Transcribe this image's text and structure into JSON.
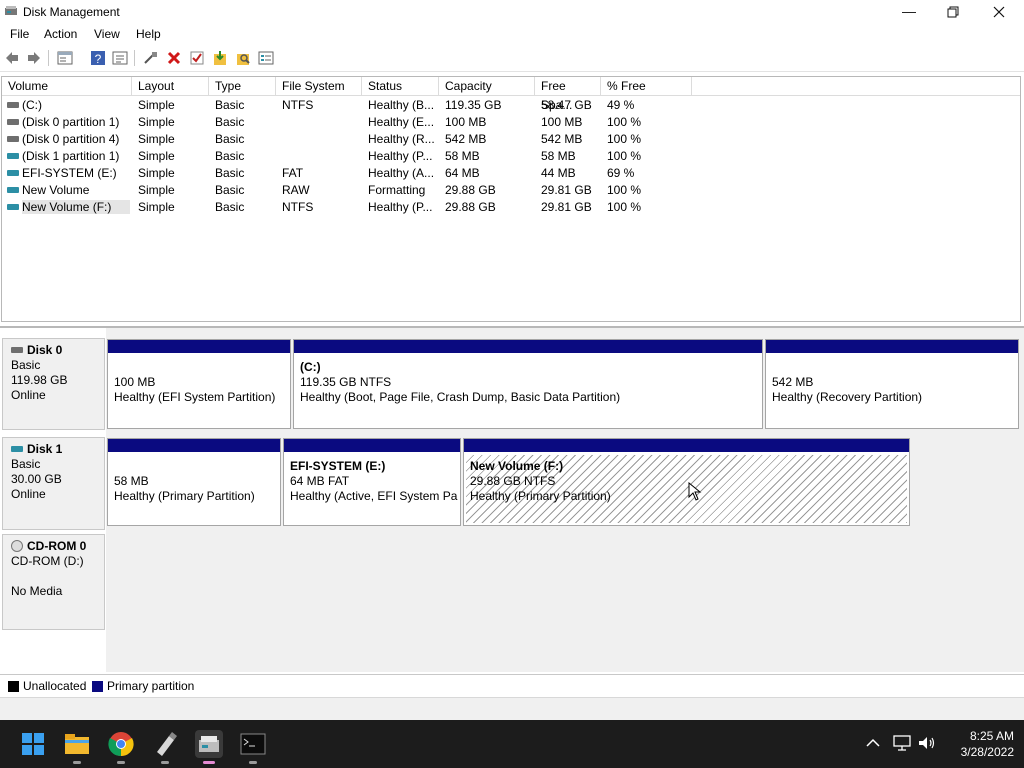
{
  "window": {
    "title": "Disk Management",
    "minimize_icon": "minimize-icon",
    "maximize_icon": "maximize-icon",
    "close_icon": "close-icon"
  },
  "menu": [
    "File",
    "Action",
    "View",
    "Help"
  ],
  "toolbar": {
    "icons": [
      "back-icon",
      "forward-icon",
      "properties-icon",
      "help-icon",
      "details-icon",
      "connect-icon",
      "delete-icon",
      "check-icon",
      "import-icon",
      "search-icon",
      "list-icon"
    ]
  },
  "volume_list": {
    "columns": [
      "Volume",
      "Layout",
      "Type",
      "File System",
      "Status",
      "Capacity",
      "Free Spa...",
      "% Free"
    ],
    "rows": [
      {
        "volume": " (C:)",
        "layout": "Simple",
        "type": "Basic",
        "fs": "NTFS",
        "status": "Healthy (B...",
        "capacity": "119.35 GB",
        "free": "58.47 GB",
        "pct": "49 %",
        "icon": "gray"
      },
      {
        "volume": "(Disk 0 partition 1)",
        "layout": "Simple",
        "type": "Basic",
        "fs": "",
        "status": "Healthy (E...",
        "capacity": "100 MB",
        "free": "100 MB",
        "pct": "100 %",
        "icon": "gray"
      },
      {
        "volume": "(Disk 0 partition 4)",
        "layout": "Simple",
        "type": "Basic",
        "fs": "",
        "status": "Healthy (R...",
        "capacity": "542 MB",
        "free": "542 MB",
        "pct": "100 %",
        "icon": "gray"
      },
      {
        "volume": "(Disk 1 partition 1)",
        "layout": "Simple",
        "type": "Basic",
        "fs": "",
        "status": "Healthy (P...",
        "capacity": "58 MB",
        "free": "58 MB",
        "pct": "100 %",
        "icon": "teal"
      },
      {
        "volume": "EFI-SYSTEM (E:)",
        "layout": "Simple",
        "type": "Basic",
        "fs": "FAT",
        "status": "Healthy (A...",
        "capacity": "64 MB",
        "free": "44 MB",
        "pct": "69 %",
        "icon": "teal"
      },
      {
        "volume": "New Volume",
        "layout": "Simple",
        "type": "Basic",
        "fs": "RAW",
        "status": "Formatting",
        "capacity": "29.88 GB",
        "free": "29.81 GB",
        "pct": "100 %",
        "icon": "teal"
      },
      {
        "volume": "New Volume (F:)",
        "layout": "Simple",
        "type": "Basic",
        "fs": "NTFS",
        "status": "Healthy (P...",
        "capacity": "29.88 GB",
        "free": "29.81 GB",
        "pct": "100 %",
        "icon": "teal"
      }
    ]
  },
  "disks": [
    {
      "name": "Disk 0",
      "kind": "Basic",
      "size": "119.98 GB",
      "state": "Online",
      "partitions": [
        {
          "title": "",
          "line1": "100 MB",
          "line2": "Healthy (EFI System Partition)"
        },
        {
          "title": "(C:)",
          "line1": "119.35 GB NTFS",
          "line2": "Healthy (Boot, Page File, Crash Dump, Basic Data Partition)"
        },
        {
          "title": "",
          "line1": "542 MB",
          "line2": "Healthy (Recovery Partition)"
        }
      ]
    },
    {
      "name": "Disk 1",
      "kind": "Basic",
      "size": "30.00 GB",
      "state": "Online",
      "partitions": [
        {
          "title": "",
          "line1": "58 MB",
          "line2": "Healthy (Primary Partition)"
        },
        {
          "title": "EFI-SYSTEM  (E:)",
          "line1": "64 MB FAT",
          "line2": "Healthy (Active, EFI System Partition)"
        },
        {
          "title": "New Volume  (F:)",
          "line1": "29.88 GB NTFS",
          "line2": "Healthy (Primary Partition)"
        }
      ]
    },
    {
      "name": "CD-ROM 0",
      "line1": "CD-ROM (D:)",
      "line2": "No Media"
    }
  ],
  "legend": {
    "unallocated": "Unallocated",
    "primary": "Primary partition",
    "unallocated_color": "#000000",
    "primary_color": "#0a0a80"
  },
  "taskbar": {
    "apps": [
      "start-icon",
      "file-explorer-icon",
      "chrome-icon",
      "usb-drive-icon",
      "disk-management-icon",
      "terminal-icon"
    ],
    "time": "8:25 AM",
    "date": "3/28/2022"
  }
}
